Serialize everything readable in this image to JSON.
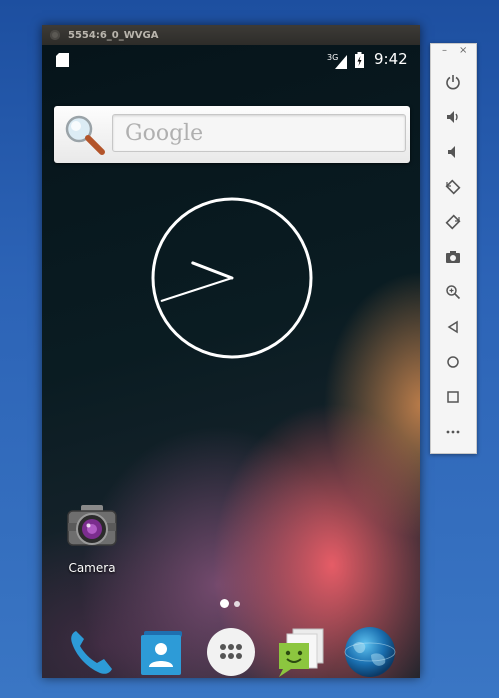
{
  "window": {
    "title": "5554:6_0_WVGA"
  },
  "status_bar": {
    "network": "3G",
    "time": "9:42"
  },
  "search_widget": {
    "placeholder": "Google"
  },
  "home_apps": [
    {
      "label": "Camera",
      "icon": "camera-icon"
    }
  ],
  "dock": [
    {
      "icon": "phone-icon"
    },
    {
      "icon": "contacts-icon"
    },
    {
      "icon": "all-apps-icon"
    },
    {
      "icon": "messaging-icon"
    },
    {
      "icon": "browser-globe-icon"
    }
  ],
  "page_indicator": {
    "pages": 2,
    "current": 1
  },
  "clock_widget": {
    "hours": 9,
    "minutes": 42
  },
  "emulator_toolbar": {
    "buttons": [
      "power-icon",
      "volume-up-icon",
      "volume-down-icon",
      "rotate-left-icon",
      "rotate-right-icon",
      "screenshot-camera-icon",
      "zoom-icon",
      "back-icon",
      "home-icon",
      "overview-icon",
      "more-icon"
    ],
    "window_controls": {
      "minimize": "–",
      "close": "×"
    }
  },
  "colors": {
    "accent_blue": "#2d9bd7",
    "desktop_blue": "#2c63b6"
  }
}
